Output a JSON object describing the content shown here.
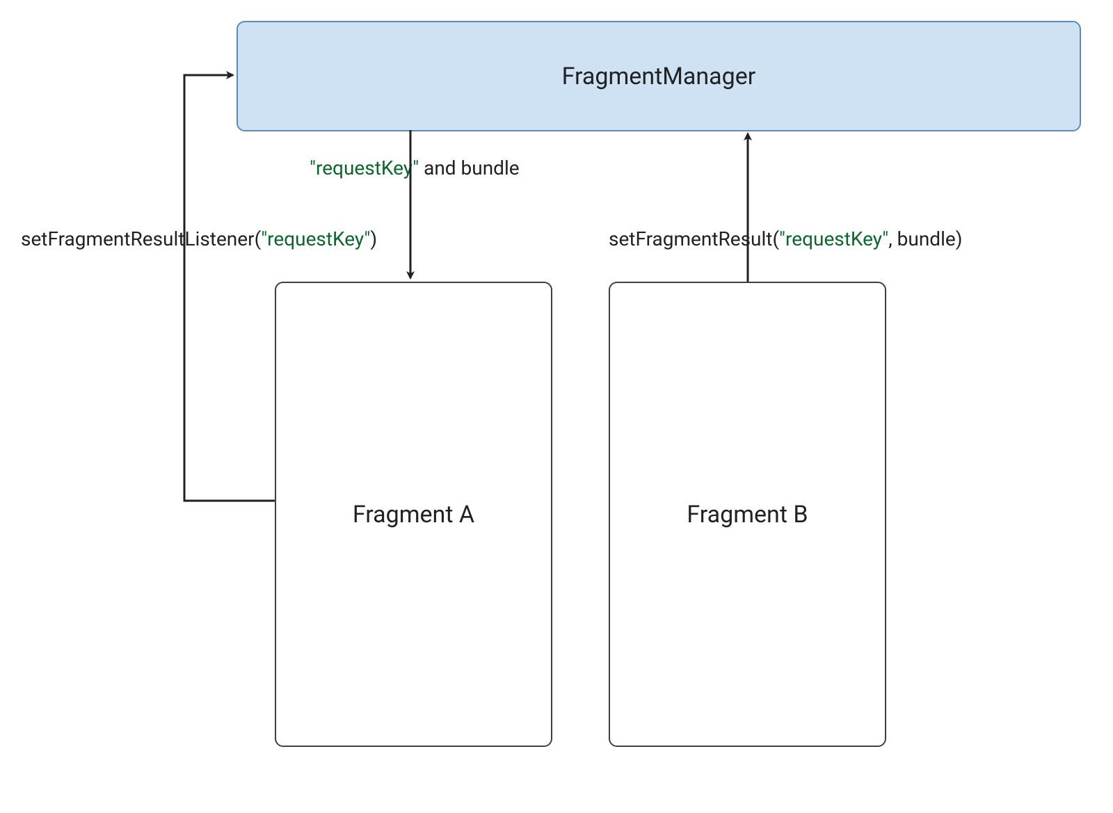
{
  "boxes": {
    "manager": {
      "label": "FragmentManager"
    },
    "fragmentA": {
      "label": "Fragment A"
    },
    "fragmentB": {
      "label": "Fragment B"
    }
  },
  "labels": {
    "listener": {
      "prefix": "setFragmentResultListener(",
      "quoted": "\"requestKey\"",
      "suffix": ")"
    },
    "bundle": {
      "quoted": "\"requestKey\"",
      "suffix": " and bundle"
    },
    "setResult": {
      "prefix": "setFragmentResult(",
      "quoted": "\"requestKey\"",
      "suffix": ", bundle)"
    }
  },
  "colors": {
    "managerFill": "#cfe2f3",
    "managerStroke": "#5b8bb2",
    "boxStroke": "#3c4043",
    "quotedText": "#0d652d"
  }
}
